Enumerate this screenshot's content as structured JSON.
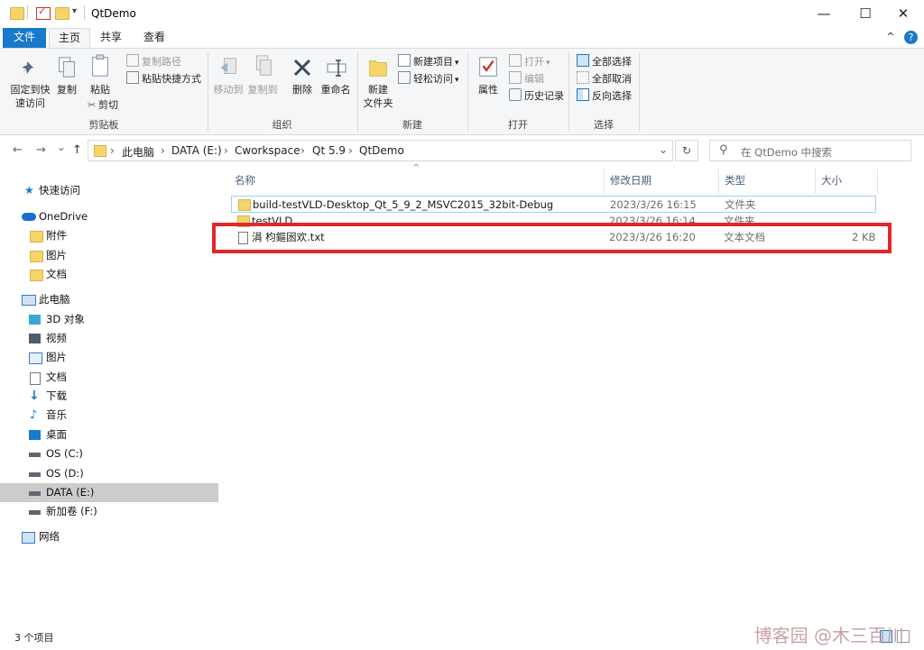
{
  "window": {
    "title": "QtDemo",
    "minimize": "—",
    "maximize": "☐",
    "close": "✕"
  },
  "ribbon_tabs": {
    "file": "文件",
    "home": "主页",
    "share": "共享",
    "view": "查看",
    "help": "?",
    "collapse": "^"
  },
  "ribbon": {
    "clipboard": {
      "pin": "固定到快速访问",
      "pin_l1": "固定到快",
      "pin_l2": "速访问",
      "copy": "复制",
      "paste": "粘贴",
      "copy_path": "复制路径",
      "paste_shortcut": "粘贴快捷方式",
      "cut": "剪切",
      "group": "剪贴板"
    },
    "organize": {
      "move_to": "移动到",
      "copy_to": "复制到",
      "delete": "删除",
      "rename": "重命名",
      "group": "组织"
    },
    "new": {
      "new_folder_l1": "新建",
      "new_folder_l2": "文件夹",
      "new_item": "新建项目",
      "easy_access": "轻松访问",
      "group": "新建"
    },
    "open": {
      "properties": "属性",
      "open": "打开",
      "edit": "编辑",
      "history": "历史记录",
      "group": "打开"
    },
    "select": {
      "select_all": "全部选择",
      "select_none": "全部取消",
      "invert": "反向选择",
      "group": "选择"
    }
  },
  "address": {
    "back": "←",
    "forward": "→",
    "recent": "⌄",
    "up": "↑",
    "crumbs": [
      "此电脑",
      "DATA (E:)",
      "Cworkspace",
      "Qt 5.9",
      "QtDemo"
    ],
    "refresh": "↻",
    "search_placeholder": "在 QtDemo 中搜索"
  },
  "nav": {
    "quick_access": "快速访问",
    "onedrive": "OneDrive",
    "od_items": [
      "附件",
      "图片",
      "文档"
    ],
    "this_pc": "此电脑",
    "pc_items": [
      "3D 对象",
      "视频",
      "图片",
      "文档",
      "下载",
      "音乐",
      "桌面",
      "OS (C:)",
      "OS (D:)",
      "DATA (E:)",
      "新加卷 (F:)"
    ],
    "network": "网络"
  },
  "columns": {
    "name": "名称",
    "modified": "修改日期",
    "type": "类型",
    "size": "大小"
  },
  "files": [
    {
      "name": "build-testVLD-Desktop_Qt_5_9_2_MSVC2015_32bit-Debug",
      "modified": "2023/3/26 16:15",
      "type": "文件夹",
      "size": ""
    },
    {
      "name": "testVLD",
      "modified": "2023/3/26 16:14",
      "type": "文件夹",
      "size": ""
    },
    {
      "name": "涓   枃鏂囦欢.txt",
      "modified": "2023/3/26 16:20",
      "type": "文本文档",
      "size": "2 KB"
    }
  ],
  "status": {
    "count": "3 个项目"
  },
  "watermark": "博客园 @木三百川",
  "colors": {
    "accent": "#1979ca",
    "highlight_box": "#e3262c",
    "folder": "#f6d46a"
  }
}
